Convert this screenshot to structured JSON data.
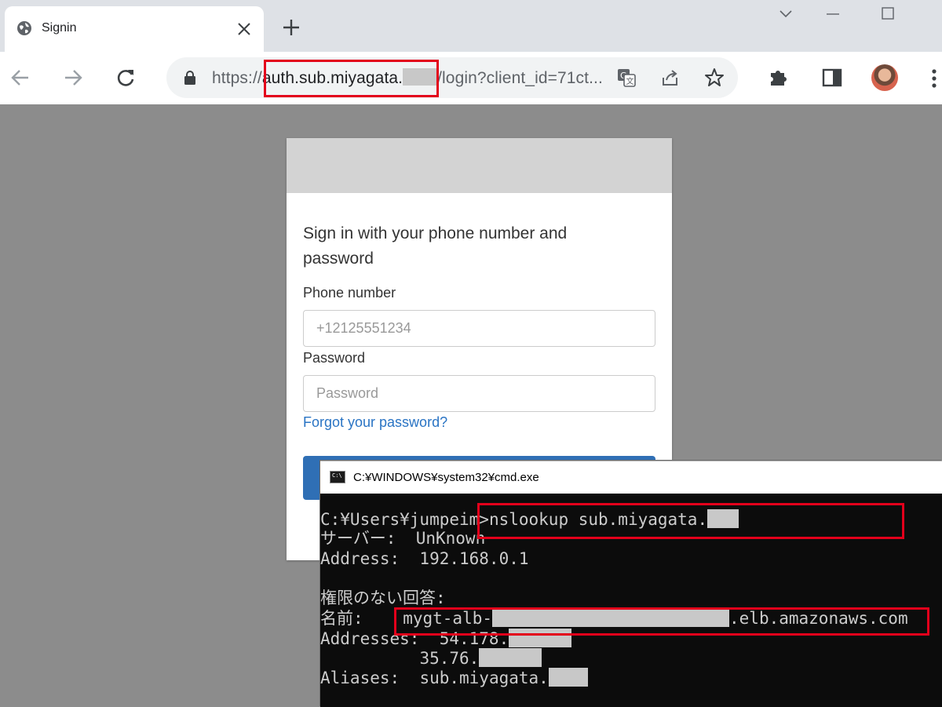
{
  "browser": {
    "tab_title": "Signin",
    "url_prefix": "https://",
    "url_host": "auth.sub.miyagata.",
    "url_path": "/login?client_id=71ct..."
  },
  "card": {
    "heading": "Sign in with your phone number and password",
    "phone_label": "Phone number",
    "phone_placeholder": "+12125551234",
    "password_label": "Password",
    "password_placeholder": "Password",
    "forgot_link": "Forgot your password?"
  },
  "cmd": {
    "title": "C:¥WINDOWS¥system32¥cmd.exe",
    "prompt": "C:¥Users¥jumpeim>",
    "command": "nslookup sub.miyagata.",
    "server_line": "サーバー:  UnKnown",
    "address_line": "Address:  192.168.0.1",
    "non_auth_line": "権限のない回答:",
    "name_label": "名前:    ",
    "name_prefix": "mygt-alb-",
    "name_suffix": ".elb.amazonaws.com",
    "addresses_label": "Addresses:  ",
    "address1": "54.178.",
    "address2_indent": "          ",
    "address2": "35.76.",
    "aliases_label": "Aliases:  ",
    "aliases_value": "sub.miyagata."
  },
  "colors": {
    "highlight": "#e3001b",
    "link": "#2a74c4",
    "button": "#2f6fb5"
  }
}
